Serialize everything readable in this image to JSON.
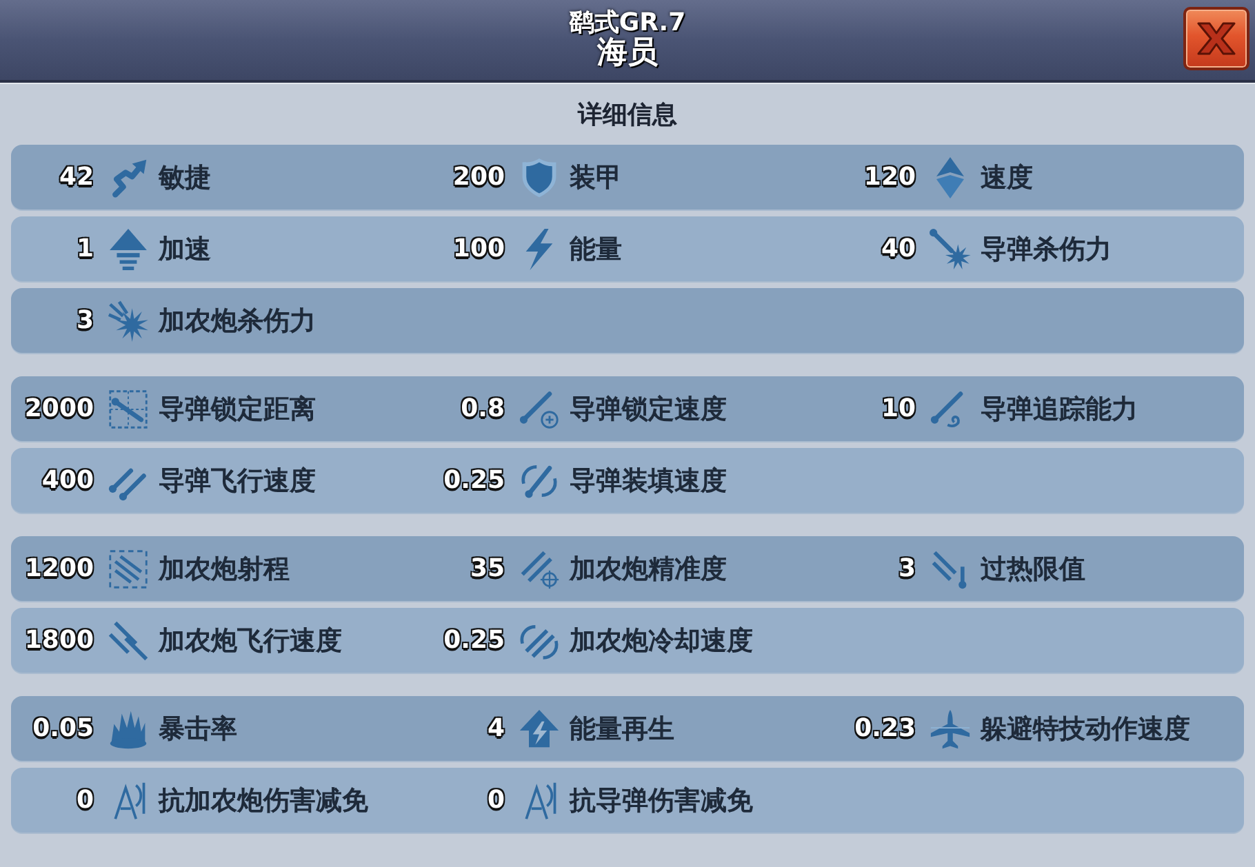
{
  "window": {
    "title": "鹞式GR.7",
    "subtitle": "海员"
  },
  "heading": "详细信息",
  "sections": [
    {
      "rows": [
        {
          "stats": [
            {
              "value": "42",
              "label": "敏捷",
              "kind": "agility"
            },
            {
              "value": "200",
              "label": "装甲",
              "kind": "armor"
            },
            {
              "value": "120",
              "label": "速度",
              "kind": "speed"
            }
          ]
        },
        {
          "stats": [
            {
              "value": "1",
              "label": "加速",
              "kind": "boost"
            },
            {
              "value": "100",
              "label": "能量",
              "kind": "energy"
            },
            {
              "value": "40",
              "label": "导弹杀伤力",
              "kind": "missiledamage"
            }
          ]
        },
        {
          "stats": [
            {
              "value": "3",
              "label": "加农炮杀伤力",
              "kind": "cannondamage"
            }
          ]
        }
      ]
    },
    {
      "rows": [
        {
          "stats": [
            {
              "value": "2000",
              "label": "导弹锁定距离",
              "kind": "lockrange"
            },
            {
              "value": "0.8",
              "label": "导弹锁定速度",
              "kind": "locktime"
            },
            {
              "value": "10",
              "label": "导弹追踪能力",
              "kind": "tracking"
            }
          ]
        },
        {
          "stats": [
            {
              "value": "400",
              "label": "导弹飞行速度",
              "kind": "missilespeed"
            },
            {
              "value": "0.25",
              "label": "导弹装填速度",
              "kind": "reload"
            }
          ]
        }
      ]
    },
    {
      "rows": [
        {
          "stats": [
            {
              "value": "1200",
              "label": "加农炮射程",
              "kind": "cannonrange"
            },
            {
              "value": "35",
              "label": "加农炮精准度",
              "kind": "accuracy"
            },
            {
              "value": "3",
              "label": "过热限值",
              "kind": "overheat"
            }
          ]
        },
        {
          "stats": [
            {
              "value": "1800",
              "label": "加农炮飞行速度",
              "kind": "cannonspeed"
            },
            {
              "value": "0.25",
              "label": "加农炮冷却速度",
              "kind": "cooldown"
            }
          ]
        }
      ]
    },
    {
      "rows": [
        {
          "stats": [
            {
              "value": "0.05",
              "label": "暴击率",
              "kind": "critical"
            },
            {
              "value": "4",
              "label": "能量再生",
              "kind": "regen"
            },
            {
              "value": "0.23",
              "label": "躲避特技动作速度",
              "kind": "evasion"
            }
          ]
        },
        {
          "stats": [
            {
              "value": "0",
              "label": "抗加农炮伤害减免",
              "kind": "cannonresist"
            },
            {
              "value": "0",
              "label": "抗导弹伤害减免",
              "kind": "missileresist"
            }
          ]
        }
      ]
    }
  ]
}
